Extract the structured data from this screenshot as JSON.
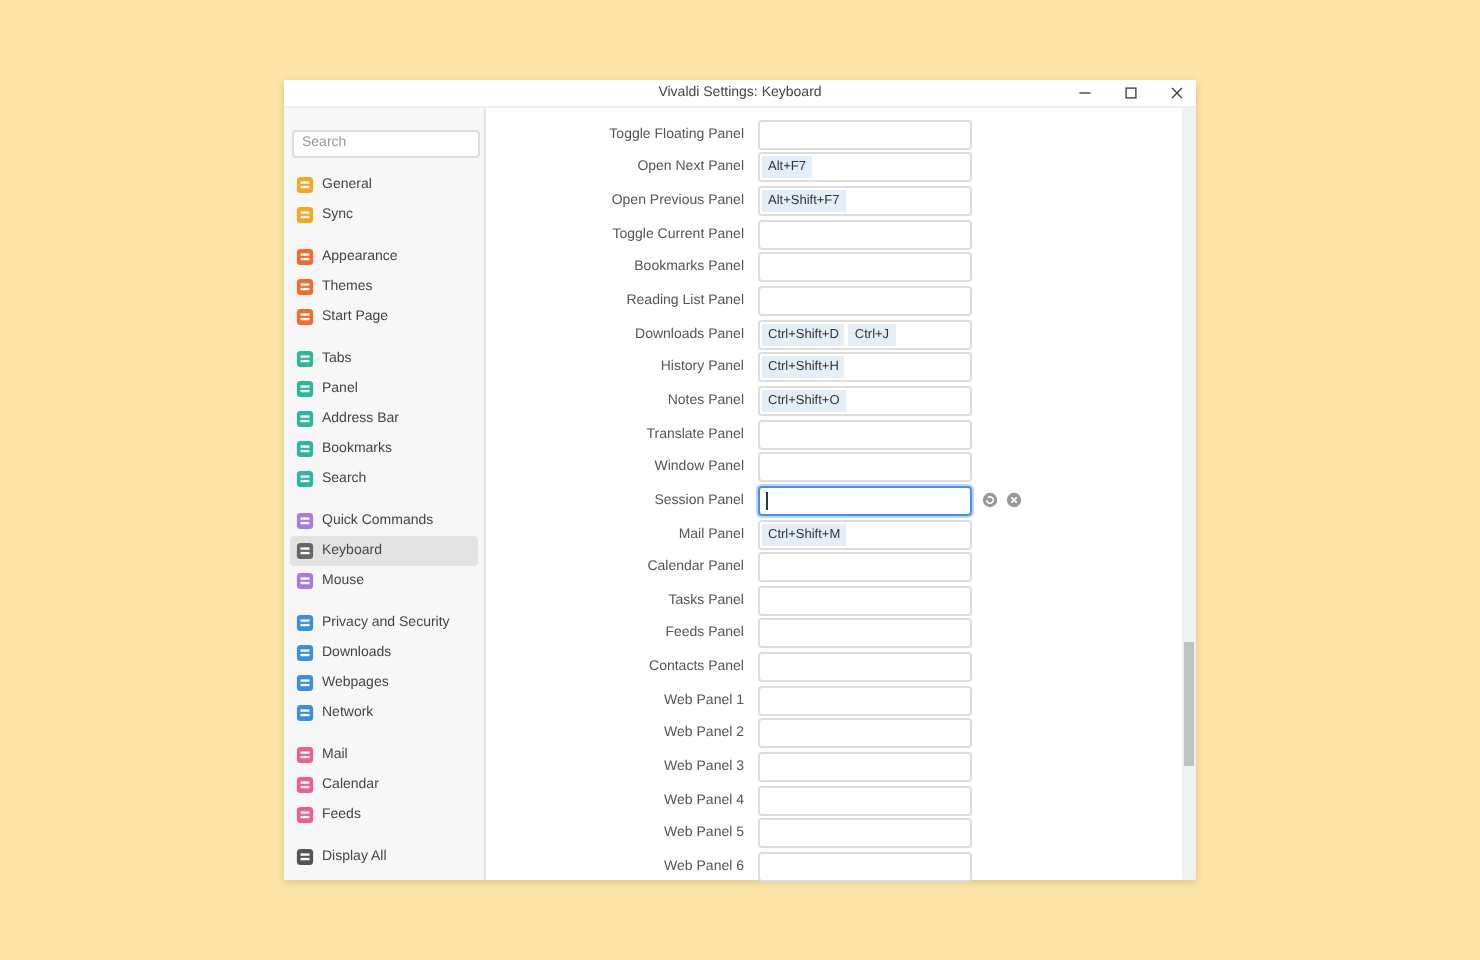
{
  "window": {
    "title": "Vivaldi Settings: Keyboard"
  },
  "search": {
    "placeholder": "Search"
  },
  "sidebar": {
    "groups": [
      [
        {
          "label": "General",
          "color": "#f5a623",
          "selected": false
        },
        {
          "label": "Sync",
          "color": "#f5a623",
          "selected": false
        }
      ],
      [
        {
          "label": "Appearance",
          "color": "#f26b2a",
          "selected": false
        },
        {
          "label": "Themes",
          "color": "#f26b2a",
          "selected": false
        },
        {
          "label": "Start Page",
          "color": "#f26b2a",
          "selected": false
        }
      ],
      [
        {
          "label": "Tabs",
          "color": "#2bb89a",
          "selected": false
        },
        {
          "label": "Panel",
          "color": "#2bb89a",
          "selected": false
        },
        {
          "label": "Address Bar",
          "color": "#2bb89a",
          "selected": false
        },
        {
          "label": "Bookmarks",
          "color": "#2bb89a",
          "selected": false
        },
        {
          "label": "Search",
          "color": "#2bb89a",
          "selected": false
        }
      ],
      [
        {
          "label": "Quick Commands",
          "color": "#a77be0",
          "selected": false
        },
        {
          "label": "Keyboard",
          "color": "#666666",
          "selected": true
        },
        {
          "label": "Mouse",
          "color": "#a77be0",
          "selected": false
        }
      ],
      [
        {
          "label": "Privacy and Security",
          "color": "#3b8fe0",
          "selected": false
        },
        {
          "label": "Downloads",
          "color": "#3b8fe0",
          "selected": false
        },
        {
          "label": "Webpages",
          "color": "#3b8fe0",
          "selected": false
        },
        {
          "label": "Network",
          "color": "#3b8fe0",
          "selected": false
        }
      ],
      [
        {
          "label": "Mail",
          "color": "#ef5d8f",
          "selected": false
        },
        {
          "label": "Calendar",
          "color": "#ef5d8f",
          "selected": false
        },
        {
          "label": "Feeds",
          "color": "#ef5d8f",
          "selected": false
        }
      ],
      [
        {
          "label": "Display All",
          "color": "#555555",
          "selected": false
        }
      ]
    ]
  },
  "shortcuts": [
    {
      "label": "Toggle Floating Panel",
      "focused": false
    },
    {
      "label": "Open Next Panel",
      "keys": [
        "Alt+F7"
      ],
      "focused": false
    },
    {
      "label": "Open Previous Panel",
      "keys": [
        "Alt+Shift+F7"
      ],
      "focused": false
    },
    {
      "label": "Toggle Current Panel",
      "focused": false
    },
    {
      "label": "Bookmarks Panel",
      "focused": false
    },
    {
      "label": "Reading List Panel",
      "focused": false
    },
    {
      "label": "Downloads Panel",
      "keys": [
        "Ctrl+Shift+D",
        "Ctrl+J"
      ],
      "focused": false
    },
    {
      "label": "History Panel",
      "keys": [
        "Ctrl+Shift+H"
      ],
      "focused": false
    },
    {
      "label": "Notes Panel",
      "keys": [
        "Ctrl+Shift+O"
      ],
      "focused": false
    },
    {
      "label": "Translate Panel",
      "focused": false
    },
    {
      "label": "Window Panel",
      "focused": false
    },
    {
      "label": "Session Panel",
      "focused": true
    },
    {
      "label": "Mail Panel",
      "keys": [
        "Ctrl+Shift+M"
      ],
      "focused": false
    },
    {
      "label": "Calendar Panel",
      "focused": false
    },
    {
      "label": "Tasks Panel",
      "focused": false
    },
    {
      "label": "Feeds Panel",
      "focused": false
    },
    {
      "label": "Contacts Panel",
      "focused": false
    },
    {
      "label": "Web Panel 1",
      "focused": false
    },
    {
      "label": "Web Panel 2",
      "focused": false
    },
    {
      "label": "Web Panel 3",
      "focused": false
    },
    {
      "label": "Web Panel 4",
      "focused": false
    },
    {
      "label": "Web Panel 5",
      "focused": false
    },
    {
      "label": "Web Panel 6",
      "focused": false
    }
  ]
}
